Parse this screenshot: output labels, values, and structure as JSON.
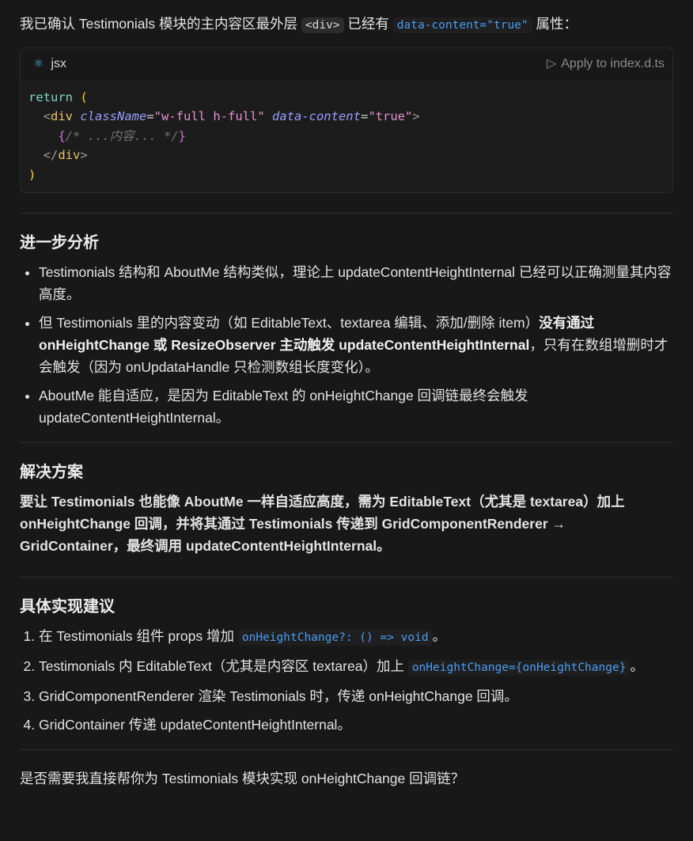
{
  "intro": {
    "pre": "我已确认 Testimonials 模块的主内容区最外层 ",
    "code1": "<div>",
    "mid": " 已经有 ",
    "code2": "data-content=\"true\"",
    "post": " 属性："
  },
  "codeblock": {
    "lang": "jsx",
    "icon": "react-icon",
    "apply_label": "Apply to index.d.ts",
    "lines": {
      "l1a": "return",
      "l1b": " (",
      "l2a": "  <",
      "l2b": "div",
      "l2c": " className",
      "l2d": "=",
      "l2e": "\"w-full h-full\"",
      "l2f": " data-content",
      "l2g": "=",
      "l2h": "\"true\"",
      "l2i": ">",
      "l3a": "    {",
      "l3b": "/* ...内容... */",
      "l3c": "}",
      "l4a": "  </",
      "l4b": "div",
      "l4c": ">",
      "l5": ")"
    }
  },
  "s1": {
    "title": "进一步分析",
    "items": [
      "Testimonials 结构和 AboutMe 结构类似，理论上 updateContentHeightInternal 已经可以正确测量其内容高度。",
      {
        "a": "但 Testimonials 里的内容变动（如 EditableText、textarea 编辑、添加/删除 item）",
        "b": "没有通过 onHeightChange 或 ResizeObserver 主动触发 updateContentHeightInternal",
        "c": "，只有在数组增删时才会触发（因为 onUpdataHandle 只检测数组长度变化）。"
      },
      "AboutMe 能自适应，是因为 EditableText 的 onHeightChange 回调链最终会触发 updateContentHeightInternal。"
    ]
  },
  "s2": {
    "title": "解决方案",
    "text": "要让 Testimonials 也能像 AboutMe 一样自适应高度，需为 EditableText（尤其是 textarea）加上 onHeightChange 回调，并将其通过 Testimonials 传递到 GridComponentRenderer → GridContainer，最终调用 updateContentHeightInternal。"
  },
  "s3": {
    "title": "具体实现建议",
    "items": [
      {
        "a": "在 Testimonials 组件 props 增加 ",
        "code": "onHeightChange?: () => void",
        "b": "。"
      },
      {
        "a": "Testimonials 内 EditableText（尤其是内容区 textarea）加上 ",
        "code": "onHeightChange={onHeightChange}",
        "b": "。"
      },
      "GridComponentRenderer 渲染 Testimonials 时，传递 onHeightChange 回调。",
      "GridContainer 传递 updateContentHeightInternal。"
    ]
  },
  "closing": "是否需要我直接帮你为 Testimonials 模块实现 onHeightChange 回调链？"
}
